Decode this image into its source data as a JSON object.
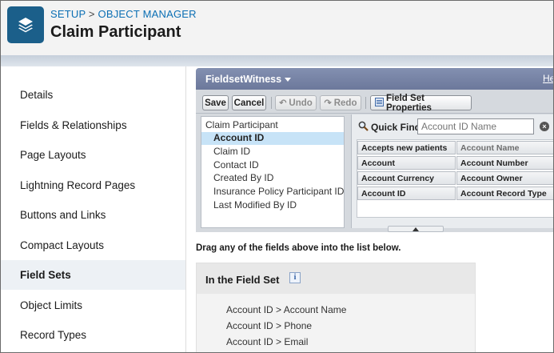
{
  "header": {
    "breadcrumb_setup": "SETUP",
    "breadcrumb_sep": ">",
    "breadcrumb_object_manager": "OBJECT MANAGER",
    "title": "Claim Participant",
    "app_icon": "layers-icon"
  },
  "sidebar": {
    "items": [
      {
        "label": "Details"
      },
      {
        "label": "Fields & Relationships"
      },
      {
        "label": "Page Layouts"
      },
      {
        "label": "Lightning Record Pages"
      },
      {
        "label": "Buttons and Links"
      },
      {
        "label": "Compact Layouts"
      },
      {
        "label": "Field Sets",
        "active": true
      },
      {
        "label": "Object Limits"
      },
      {
        "label": "Record Types"
      }
    ]
  },
  "fieldset_editor": {
    "title": "FieldsetWitness",
    "help_label": "He",
    "toolbar": {
      "save": "Save",
      "cancel": "Cancel",
      "undo": "Undo",
      "redo": "Redo",
      "properties": "Field Set Properties"
    },
    "tree": {
      "root": "Claim Participant",
      "items": [
        {
          "label": "Account ID",
          "selected": true
        },
        {
          "label": "Claim ID"
        },
        {
          "label": "Contact ID"
        },
        {
          "label": "Created By ID"
        },
        {
          "label": "Insurance Policy Participant ID"
        },
        {
          "label": "Last Modified By ID"
        }
      ]
    },
    "quick_find": {
      "label": "Quick Find",
      "placeholder": "Account ID Name",
      "value": ""
    },
    "field_grid": {
      "rows": [
        [
          "Accepts new patients",
          "Account Name"
        ],
        [
          "Account",
          "Account Number"
        ],
        [
          "Account Currency",
          "Account Owner"
        ],
        [
          "Account ID",
          "Account Record Type"
        ]
      ],
      "dimmed": [
        "Account Name"
      ]
    }
  },
  "drag_hint": "Drag any of the fields above into the list below.",
  "in_field_set": {
    "title": "In the Field Set",
    "info_icon": "i",
    "fields": [
      "Account ID > Account Name",
      "Account ID > Phone",
      "Account ID > Email"
    ]
  },
  "colors": {
    "accent_link": "#0b6fb4",
    "app_icon_bg": "#1b5f8a",
    "panel_title_bar": "#6c789b",
    "selection": "#c7e3f7"
  }
}
